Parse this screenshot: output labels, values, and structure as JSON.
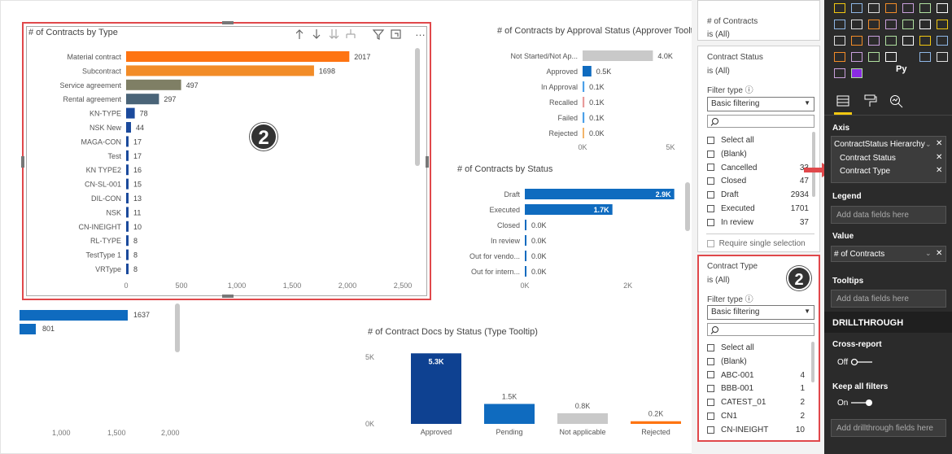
{
  "colors": {
    "orange": "#f28c28",
    "brightOrange": "#fe7412",
    "olive": "#7f7f65",
    "slate": "#4a6478",
    "navy": "#1b4a9c",
    "blue": "#0f6bbf",
    "lightBlue": "#4ba0e8",
    "grey": "#c9c9c9",
    "darkNavy": "#0e4191",
    "highlightRed": "#e0484b",
    "paneBg": "#2b2b2b"
  },
  "contracts_by_type": {
    "title": "# of Contracts by Type",
    "header_icons": [
      "arrow-up-icon",
      "arrow-down-icon",
      "double-arrow-down-icon",
      "expand-hierarchy-icon",
      "filter-icon",
      "focus-mode-icon",
      "more-options-icon"
    ],
    "more_label": "…",
    "x_ticks": [
      "0",
      "500",
      "1,000",
      "1,500",
      "2,000",
      "2,500"
    ],
    "badge": "2"
  },
  "approval_status": {
    "title": "# of Contracts by Approval Status (Approver Tooltip)",
    "x_ticks": [
      "0K",
      "5K"
    ]
  },
  "contracts_by_status": {
    "title": "# of Contracts by Status",
    "x_ticks": [
      "0K",
      "2K"
    ]
  },
  "contract_docs": {
    "title": "# of Contract Docs by Status (Type Tooltip)",
    "y_ticks": [
      "5K",
      "0K"
    ]
  },
  "bottom_left": {
    "values": [
      "1637",
      "801"
    ],
    "x_ticks": [
      "1,000",
      "1,500",
      "2,000"
    ]
  },
  "filters": {
    "top_card": {
      "title": "# of Contracts",
      "sub": "is (All)"
    },
    "status_card": {
      "title": "Contract Status",
      "sub": "is (All)",
      "filter_type_label": "Filter type ⓘ",
      "filter_type_value": "Basic filtering",
      "items": [
        {
          "label": "Select all",
          "count": ""
        },
        {
          "label": "(Blank)",
          "count": ""
        },
        {
          "label": "Cancelled",
          "count": "33"
        },
        {
          "label": "Closed",
          "count": "47"
        },
        {
          "label": "Draft",
          "count": "2934"
        },
        {
          "label": "Executed",
          "count": "1701"
        },
        {
          "label": "In review",
          "count": "37"
        }
      ],
      "require_single": "Require single selection"
    },
    "type_card": {
      "title": "Contract Type",
      "sub": "is (All)",
      "filter_type_label": "Filter type ⓘ",
      "filter_type_value": "Basic filtering",
      "items": [
        {
          "label": "Select all",
          "count": ""
        },
        {
          "label": "(Blank)",
          "count": ""
        },
        {
          "label": "ABC-001",
          "count": "4"
        },
        {
          "label": "BBB-001",
          "count": "1"
        },
        {
          "label": "CATEST_01",
          "count": "2"
        },
        {
          "label": "CN1",
          "count": "2"
        },
        {
          "label": "CN-INEIGHT",
          "count": "10"
        }
      ],
      "badge": "2"
    }
  },
  "pane": {
    "py_label": "Py",
    "axis_label": "Axis",
    "axis_fields": [
      "ContractStatus Hierarchy",
      "Contract Status",
      "Contract Type"
    ],
    "legend_label": "Legend",
    "legend_placeholder": "Add data fields here",
    "value_label": "Value",
    "value_field": "# of Contracts",
    "tooltips_label": "Tooltips",
    "tooltips_placeholder": "Add data fields here",
    "drillthrough_label": "DRILLTHROUGH",
    "cross_report_label": "Cross-report",
    "cross_report_value": "Off",
    "keep_filters_label": "Keep all filters",
    "keep_filters_value": "On",
    "drill_placeholder": "Add drillthrough fields here"
  },
  "chart_data": [
    {
      "type": "bar",
      "title": "# of Contracts by Type",
      "orientation": "horizontal",
      "categories": [
        "Material contract",
        "Subcontract",
        "Service agreement",
        "Rental agreement",
        "KN-TYPE",
        "NSK New",
        "MAGA-CON",
        "Test",
        "KN TYPE2",
        "CN-SL-001",
        "DIL-CON",
        "NSK",
        "CN-INEIGHT",
        "RL-TYPE",
        "TestType 1",
        "VRType"
      ],
      "values": [
        2017,
        1698,
        497,
        297,
        78,
        44,
        17,
        17,
        16,
        15,
        13,
        11,
        10,
        8,
        8,
        8
      ],
      "value_labels": [
        "2017",
        "1698",
        "497",
        "297",
        "78",
        "44",
        "17",
        "17",
        "16",
        "15",
        "13",
        "11",
        "10",
        "8",
        "8",
        "8"
      ],
      "colors": [
        "#fe7412",
        "#f28c28",
        "#7f7f65",
        "#4a6478",
        "#1b4a9c",
        "#1b4a9c",
        "#1b4a9c",
        "#1b4a9c",
        "#1b4a9c",
        "#1b4a9c",
        "#1b4a9c",
        "#1b4a9c",
        "#1b4a9c",
        "#1b4a9c",
        "#1b4a9c",
        "#1b4a9c"
      ],
      "xlim": [
        0,
        2500
      ]
    },
    {
      "type": "bar",
      "title": "# of Contracts by Approval Status (Approver Tooltip)",
      "orientation": "horizontal",
      "categories": [
        "Not Started/Not Ap...",
        "Approved",
        "In Approval",
        "Recalled",
        "Failed",
        "Rejected"
      ],
      "values": [
        4.0,
        0.5,
        0.1,
        0.1,
        0.1,
        0.0
      ],
      "value_labels": [
        "4.0K",
        "0.5K",
        "0.1K",
        "0.1K",
        "0.1K",
        "0.0K"
      ],
      "colors": [
        "#c9c9c9",
        "#0f6bbf",
        "#4ba0e8",
        "#e89a9a",
        "#4ba0e8",
        "#f2b46a"
      ],
      "xlim": [
        0,
        5
      ]
    },
    {
      "type": "bar",
      "title": "# of Contracts by Status",
      "orientation": "horizontal",
      "categories": [
        "Draft",
        "Executed",
        "Closed",
        "In review",
        "Out for vendo...",
        "Out for intern..."
      ],
      "values": [
        2.9,
        1.7,
        0.0,
        0.0,
        0.0,
        0.0
      ],
      "value_labels": [
        "2.9K",
        "1.7K",
        "0.0K",
        "0.0K",
        "0.0K",
        "0.0K"
      ],
      "colors": [
        "#0f6bbf",
        "#0f6bbf",
        "#0f6bbf",
        "#0f6bbf",
        "#0f6bbf",
        "#0f6bbf"
      ],
      "xlim": [
        0,
        3
      ]
    },
    {
      "type": "bar",
      "title": "# of Contract Docs by Status (Type Tooltip)",
      "orientation": "vertical",
      "categories": [
        "Approved",
        "Pending",
        "Not applicable",
        "Rejected"
      ],
      "values": [
        5.3,
        1.5,
        0.8,
        0.2
      ],
      "value_labels": [
        "5.3K",
        "1.5K",
        "0.8K",
        "0.2K"
      ],
      "colors": [
        "#0e4191",
        "#0f6bbf",
        "#c9c9c9",
        "#fe7412"
      ],
      "ylim": [
        0,
        5.5
      ]
    }
  ]
}
